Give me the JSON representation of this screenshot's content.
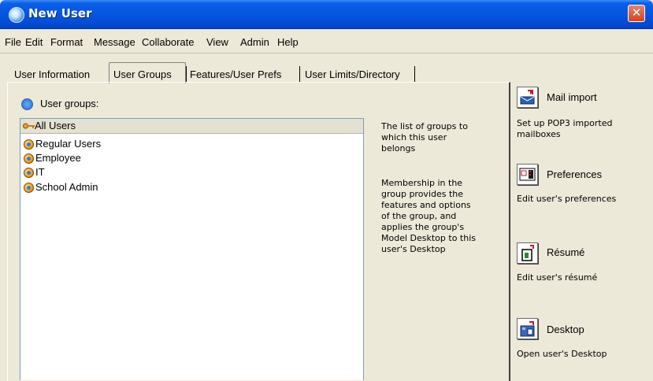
{
  "window": {
    "title": "New User",
    "close_glyph": "✕"
  },
  "menu": [
    "File",
    "Edit",
    "Format",
    "Message",
    "Collaborate",
    "View",
    "Admin",
    "Help"
  ],
  "tabs": [
    "User Information",
    "User Groups",
    "Features/User Prefs",
    "User Limits/Directory"
  ],
  "active_tab": "User Groups",
  "groups_label": "User groups:",
  "list": {
    "header": "All Users",
    "items": [
      "Regular Users",
      "Employee",
      "IT",
      "School Admin"
    ]
  },
  "description": {
    "para1": [
      "The list of groups to",
      "which this user",
      "belongs"
    ],
    "para2": [
      "Membership in the",
      "group provides the",
      "features and options",
      "of the group, and",
      "applies the group's",
      "Model Desktop to this",
      "user's Desktop"
    ]
  },
  "actions": [
    {
      "title": "Mail import",
      "desc": [
        "Set up POP3 imported",
        "mailboxes"
      ],
      "icon": "mail-import-icon"
    },
    {
      "title": "Preferences",
      "desc": [
        "Edit user's preferences"
      ],
      "icon": "preferences-icon"
    },
    {
      "title": "Résumé",
      "desc": [
        "Edit user's résumé"
      ],
      "icon": "resume-icon"
    },
    {
      "title": "Desktop",
      "desc": [
        "Open user's Desktop"
      ],
      "icon": "desktop-icon"
    }
  ],
  "colors": {
    "titlebar": "#0555e0",
    "window_bg": "#ece9d8",
    "close": "#d2431f"
  }
}
